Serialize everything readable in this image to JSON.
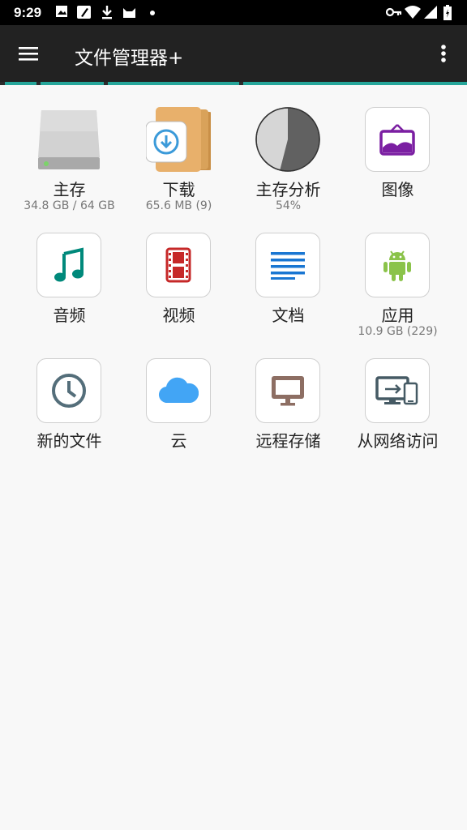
{
  "status_bar": {
    "time": "9:29",
    "icons": [
      "image-icon",
      "note-icon",
      "download-icon",
      "cat-icon",
      "dot-icon",
      "key-icon",
      "wifi-icon",
      "signal-icon",
      "battery-icon"
    ]
  },
  "app_bar": {
    "title": "文件管理器+",
    "menu_icon": "hamburger-icon",
    "overflow_icon": "more-vert-icon"
  },
  "colors": {
    "accent": "#26a69a",
    "appbar": "#222222",
    "music": "#00897b",
    "video": "#c62828",
    "docs": "#1976d2",
    "android": "#8bc34a",
    "cloud": "#42a5f5",
    "remote": "#8d6e63",
    "images": "#7b1fa2",
    "recent": "#546e7a"
  },
  "tiles": [
    {
      "label": "主存",
      "sub": "34.8 GB / 64 GB",
      "icon": "storage-drive-icon"
    },
    {
      "label": "下载",
      "sub": "65.6 MB (9)",
      "icon": "download-folder-icon"
    },
    {
      "label": "主存分析",
      "sub": "54%",
      "icon": "pie-chart-icon",
      "usage_fraction": 0.54
    },
    {
      "label": "图像",
      "sub": "",
      "icon": "image-frame-icon"
    },
    {
      "label": "音频",
      "sub": "",
      "icon": "music-note-icon"
    },
    {
      "label": "视频",
      "sub": "",
      "icon": "film-strip-icon"
    },
    {
      "label": "文档",
      "sub": "",
      "icon": "document-lines-icon"
    },
    {
      "label": "应用",
      "sub": "10.9 GB (229)",
      "icon": "android-icon"
    },
    {
      "label": "新的文件",
      "sub": "",
      "icon": "clock-icon"
    },
    {
      "label": "云",
      "sub": "",
      "icon": "cloud-icon"
    },
    {
      "label": "远程存储",
      "sub": "",
      "icon": "monitor-icon"
    },
    {
      "label": "从网络访问",
      "sub": "",
      "icon": "devices-icon"
    }
  ]
}
